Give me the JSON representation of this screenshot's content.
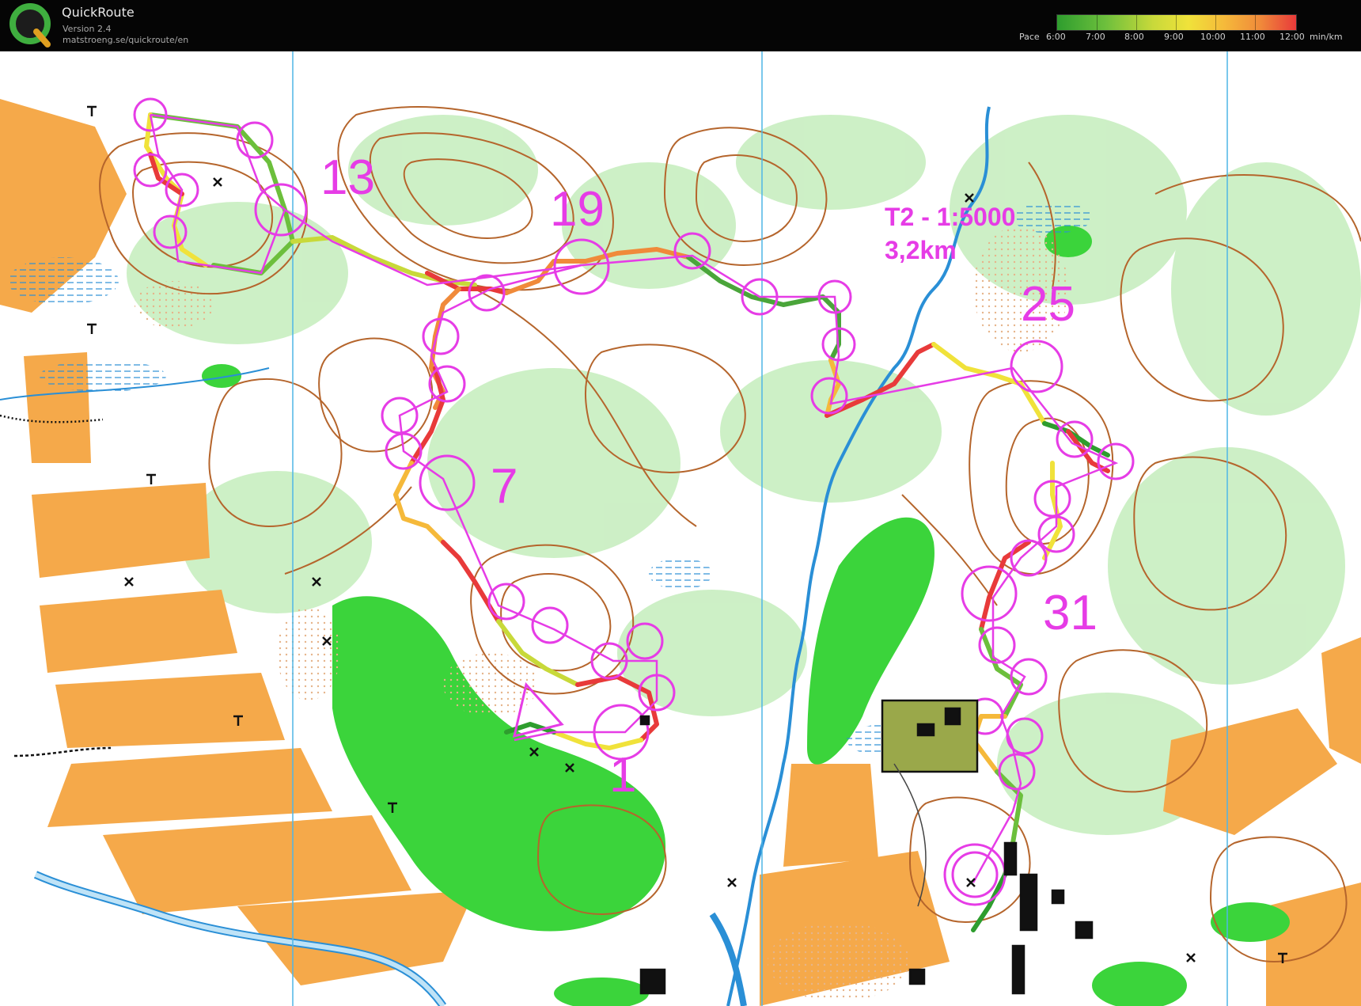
{
  "app": {
    "title": "QuickRoute",
    "version": "Version 2.4",
    "url": "matstroeng.se/quickroute/en"
  },
  "pace_legend": {
    "label": "Pace",
    "ticks": [
      "6:00",
      "7:00",
      "8:00",
      "9:00",
      "10:00",
      "11:00",
      "12:00"
    ],
    "unit": "min/km",
    "colors": [
      "#2e9d2e",
      "#c8d93a",
      "#f0e23a",
      "#f08a3a",
      "#e83a3a"
    ]
  },
  "map": {
    "course_info_line1": "T2 - 1:5000",
    "course_info_line2": "3,2km",
    "control_numbers": [
      "1",
      "7",
      "13",
      "19",
      "25",
      "31"
    ],
    "colors": {
      "course_magenta": "#e63ce6",
      "contour_brown": "#b5652c",
      "field_orange": "#f5a94a",
      "vegetation_green": "#3bd43b",
      "light_green": "#c8eec0",
      "water_blue": "#2a8fd6"
    }
  }
}
